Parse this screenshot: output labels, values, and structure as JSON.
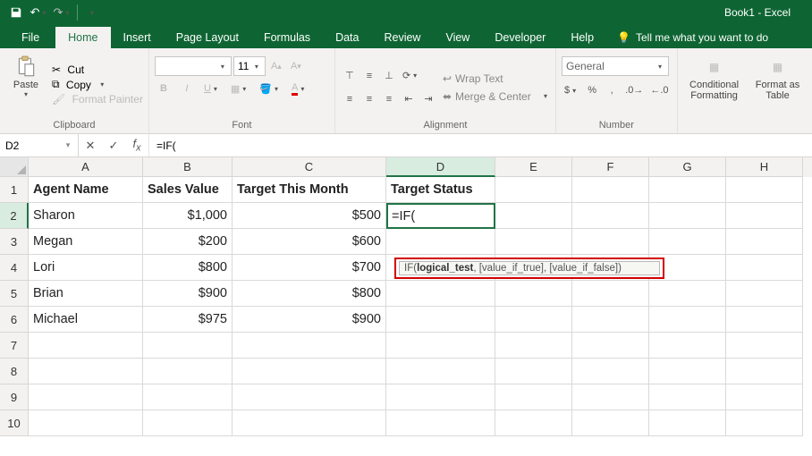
{
  "title": "Book1 - Excel",
  "qat": {
    "save": "save",
    "undo": "undo",
    "redo": "redo"
  },
  "tabs": [
    "File",
    "Home",
    "Insert",
    "Page Layout",
    "Formulas",
    "Data",
    "Review",
    "View",
    "Developer",
    "Help"
  ],
  "active_tab": "Home",
  "tellme": "Tell me what you want to do",
  "ribbon": {
    "clipboard": {
      "paste": "Paste",
      "cut": "Cut",
      "copy": "Copy",
      "fp": "Format Painter",
      "label": "Clipboard"
    },
    "font": {
      "name": "",
      "size": "11",
      "bold": "B",
      "italic": "I",
      "underline": "U",
      "label": "Font"
    },
    "alignment": {
      "wrap": "Wrap Text",
      "merge": "Merge & Center",
      "label": "Alignment"
    },
    "number": {
      "fmt": "General",
      "label": "Number"
    },
    "styles": {
      "cf": "Conditional Formatting",
      "fat": "Format as Table",
      "label": ""
    }
  },
  "namebox": "D2",
  "formula": "=IF(",
  "cols": [
    "A",
    "B",
    "C",
    "D",
    "E",
    "F",
    "G",
    "H"
  ],
  "rows": [
    "1",
    "2",
    "3",
    "4",
    "5",
    "6",
    "7",
    "8",
    "9",
    "10"
  ],
  "data": {
    "h": {
      "A": "Agent Name",
      "B": "Sales Value",
      "C": "Target This Month",
      "D": "Target Status"
    },
    "r2": {
      "A": "Sharon",
      "B": "$1,000",
      "C": "$500",
      "D": "=IF("
    },
    "r3": {
      "A": "Megan",
      "B": "$200",
      "C": "$600"
    },
    "r4": {
      "A": "Lori",
      "B": "$800",
      "C": "$700"
    },
    "r5": {
      "A": "Brian",
      "B": "$900",
      "C": "$800"
    },
    "r6": {
      "A": "Michael",
      "B": "$975",
      "C": "$900"
    }
  },
  "tooltip": {
    "fn": "IF(",
    "p1": "logical_test",
    "p2": ", [value_if_true], [value_if_false])"
  }
}
